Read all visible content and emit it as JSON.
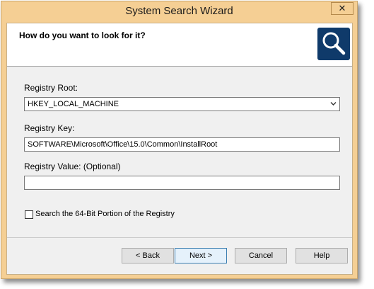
{
  "window": {
    "title": "System Search Wizard",
    "close_glyph": "✕"
  },
  "header": {
    "question": "How do you want to look for it?",
    "icon": "magnifier-icon"
  },
  "form": {
    "root_label": "Registry Root:",
    "root_value": "HKEY_LOCAL_MACHINE",
    "key_label": "Registry Key:",
    "key_value": "SOFTWARE\\Microsoft\\Office\\15.0\\Common\\InstallRoot",
    "value_label": "Registry Value: (Optional)",
    "value_value": "",
    "checkbox_label": "Search the 64-Bit Portion of the Registry",
    "checkbox_checked": false
  },
  "buttons": {
    "back": "< Back",
    "next": "Next >",
    "cancel": "Cancel",
    "help": "Help"
  },
  "colors": {
    "titlebar": "#f5cf94",
    "icon_bg": "#0f3a6a"
  }
}
